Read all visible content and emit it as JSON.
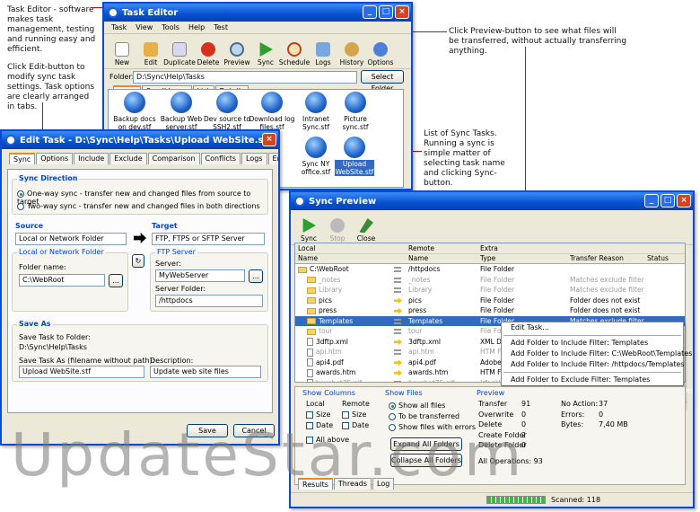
{
  "annotations": {
    "a1": "Task Editor - software makes task management, testing and running easy and efficient.",
    "a2": "Click Edit-button to modify sync task settings. Task options are clearly arranged in tabs.",
    "a3": "Click Preview-button to see what files will be transferred, without actually transferring anything.",
    "a4": "List of Sync Tasks. Running a sync is simple matter of selecting task name and clicking Sync-button."
  },
  "task_editor": {
    "title": "Task Editor",
    "menu": [
      "Task",
      "View",
      "Tools",
      "Help",
      "Test"
    ],
    "toolbar": [
      "New",
      "Edit",
      "Duplicate",
      "Delete",
      "Preview",
      "Sync",
      "Schedule",
      "Logs",
      "History",
      "Options"
    ],
    "folder_label": "Folder:",
    "folder_value": "D:\\Sync\\Help\\Tasks",
    "select_folder": "Select Folder",
    "view_tabs": [
      "Icons",
      "Small Icons",
      "List",
      "Details"
    ],
    "files": [
      {
        "l1": "Backup docs",
        "l2": "on dev.stf"
      },
      {
        "l1": "Backup Web",
        "l2": "server.stf"
      },
      {
        "l1": "Dev source to",
        "l2": "SSH2.stf"
      },
      {
        "l1": "Download log",
        "l2": "files.stf"
      },
      {
        "l1": "Intranet",
        "l2": "Sync.stf"
      },
      {
        "l1": "Picture",
        "l2": "sync.stf"
      },
      {
        "l1": "Sync NY",
        "l2": "office.stf"
      },
      {
        "l1": "Upload",
        "l2": "WebSite.stf"
      }
    ]
  },
  "edit_task": {
    "title": "Edit Task - D:\\Sync\\Help\\Tasks\\Upload WebSite.stf",
    "tabs": [
      "Sync",
      "Options",
      "Include",
      "Exclude",
      "Comparison",
      "Conflicts",
      "Logs",
      "Email"
    ],
    "sync_direction_title": "Sync Direction",
    "opt1": "One-way sync - transfer new and changed files from source to target",
    "opt2": "Two-way sync - transfer new and changed files in both directions",
    "source_label": "Source",
    "source_value": "Local or Network Folder",
    "target_label": "Target",
    "target_value": "FTP, FTPS or SFTP Server",
    "local_group": "Local or Network Folder",
    "folder_name_label": "Folder name:",
    "folder_name_value": "C:\\WebRoot",
    "ftp_group": "FTP Server",
    "server_label": "Server:",
    "server_value": "MyWebServer",
    "server_folder_label": "Server Folder:",
    "server_folder_value": "/httpdocs",
    "browse": "...",
    "save_as_title": "Save As",
    "save_to_label": "Save Task to Folder:",
    "save_to_value": "D:\\Sync\\Help\\Tasks",
    "save_as_label": "Save Task As (filename without path):",
    "save_as_value": "Upload WebSite.stf",
    "desc_label": "Description:",
    "desc_value": "Update web site files",
    "save": "Save",
    "cancel": "Cancel"
  },
  "sync_preview": {
    "title": "Sync Preview",
    "toolbar": [
      "Sync",
      "Stop",
      "Close"
    ],
    "hdr_local": "Local",
    "hdr_remote": "Remote",
    "hdr_extra": "Extra",
    "cols": [
      "Name",
      "Name",
      "Type",
      "Transfer Reason",
      "Status"
    ],
    "rows": [
      {
        "ln": "C:\\WebRoot",
        "i": "eq",
        "rn": "/httpdocs",
        "t": "File Folder",
        "r": "",
        "g": false,
        "ind": 0
      },
      {
        "ln": "_notes",
        "i": "eq",
        "rn": "_notes",
        "t": "File Folder",
        "r": "Matches exclude filter",
        "g": true,
        "ind": 1
      },
      {
        "ln": "Library",
        "i": "eq",
        "rn": "Library",
        "t": "File Folder",
        "r": "Matches exclude filter",
        "g": true,
        "ind": 1
      },
      {
        "ln": "pics",
        "i": "arr",
        "rn": "pics",
        "t": "File Folder",
        "r": "Folder does not exist",
        "g": false,
        "ind": 1
      },
      {
        "ln": "press",
        "i": "arr",
        "rn": "press",
        "t": "File Folder",
        "r": "Folder does not exist",
        "g": false,
        "ind": 1
      },
      {
        "ln": "Templates",
        "i": "eq",
        "rn": "Templates",
        "t": "File Folder",
        "r": "Matches exclude filter",
        "g": false,
        "ind": 1,
        "sel": true
      },
      {
        "ln": "tour",
        "i": "eq",
        "rn": "tour",
        "t": "File Fo",
        "r": "",
        "g": true,
        "ind": 1
      },
      {
        "ln": "3dftp.xml",
        "i": "arr",
        "rn": "3dftp.xml",
        "t": "XML Do",
        "r": "",
        "g": false,
        "ind": 1
      },
      {
        "ln": "api.htm",
        "i": "eq",
        "rn": "api.htm",
        "t": "HTM Fi",
        "r": "",
        "g": true,
        "ind": 1
      },
      {
        "ln": "api4.pdf",
        "i": "arr",
        "rn": "api4.pdf",
        "t": "Adobe",
        "r": "",
        "g": false,
        "ind": 1
      },
      {
        "ln": "awards.htm",
        "i": "arr",
        "rn": "awards.htm",
        "t": "HTM Fi",
        "r": "",
        "g": false,
        "ind": 1
      },
      {
        "ln": "boxshot75.gif",
        "i": "eq",
        "rn": "boxshot75.gif",
        "t": "IrfanV",
        "r": "",
        "g": true,
        "ind": 1
      }
    ],
    "context_menu": [
      "Edit Task...",
      "-",
      "Add Folder to Include Filter: Templates",
      "Add Folder to Include Filter: C:\\WebRoot\\Templates",
      "Add Folder to Include Filter: /httpdocs/Templates",
      "-",
      "Add Folder to Exclude Filter: Templates",
      "Add Folder to Exclude Filter: C:\\WebRoot\\Templates",
      "Add Folder to Exclude Filter: /httpdocs/Templates"
    ],
    "show_columns": "Show Columns",
    "local": "Local",
    "remote": "Remote",
    "size": "Size",
    "date": "Date",
    "all_above": "All above",
    "show_files": "Show Files",
    "sf1": "Show all files",
    "sf2": "To be transferred",
    "sf3": "Show files with errors",
    "expand": "Expand All Folders",
    "collapse": "Collapse All Folders",
    "preview_title": "Preview",
    "stats_left": [
      {
        "k": "Transfer",
        "v": "91"
      },
      {
        "k": "Overwrite",
        "v": "0"
      },
      {
        "k": "Delete",
        "v": "0"
      },
      {
        "k": "Create Folder",
        "v": "2"
      },
      {
        "k": "Delete Folder",
        "v": "0"
      }
    ],
    "stats_right": [
      {
        "k": "No Action:",
        "v": "37"
      },
      {
        "k": "Errors:",
        "v": "0"
      },
      {
        "k": "Bytes:",
        "v": "7,40 MB"
      }
    ],
    "all_ops": "All Operations: 93",
    "bottom_tabs": [
      "Results",
      "Threads",
      "Log"
    ],
    "scanned": "Scanned: 118",
    "progress": 1.0
  },
  "watermark": "UpdateStar.com"
}
